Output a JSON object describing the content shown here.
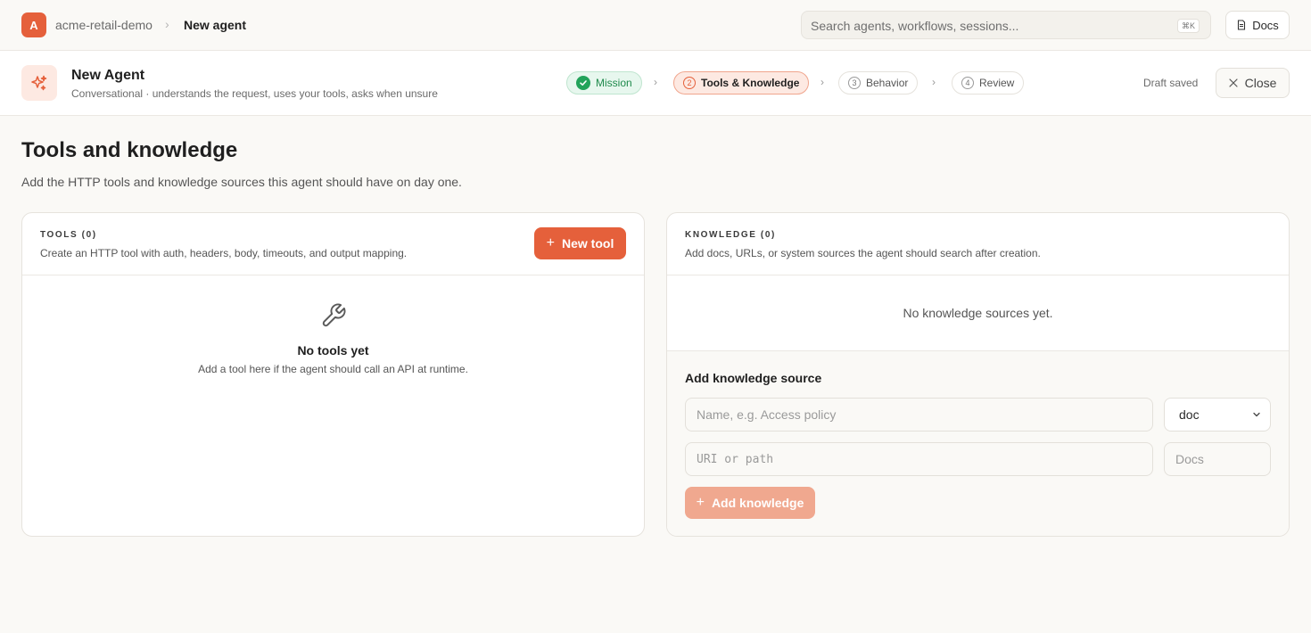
{
  "topbar": {
    "workspace_initial": "A",
    "workspace_name": "acme-retail-demo",
    "crumb_separator": "›",
    "current_page": "New agent",
    "search_placeholder": "Search agents, workflows, sessions...",
    "search_shortcut": "⌘K",
    "docs_label": "Docs"
  },
  "agent": {
    "title": "New Agent",
    "subtitle": "Conversational · understands the request, uses your tools, asks when unsure"
  },
  "steps": [
    {
      "number": "1",
      "label": "Mission",
      "state": "done"
    },
    {
      "number": "2",
      "label": "Tools & Knowledge",
      "state": "active"
    },
    {
      "number": "3",
      "label": "Behavior",
      "state": "upcoming"
    },
    {
      "number": "4",
      "label": "Review",
      "state": "upcoming"
    }
  ],
  "step_chevron": "›",
  "draft_status": "Draft saved",
  "close_label": "Close",
  "page": {
    "title": "Tools and knowledge",
    "subtitle": "Add the HTTP tools and knowledge sources this agent should have on day one."
  },
  "tools": {
    "label": "TOOLS (0)",
    "description": "Create an HTTP tool with auth, headers, body, timeouts, and output mapping.",
    "new_button": "New tool",
    "empty_title": "No tools yet",
    "empty_description": "Add a tool here if the agent should call an API at runtime."
  },
  "knowledge": {
    "label": "KNOWLEDGE (0)",
    "description": "Add docs, URLs, or system sources the agent should search after creation.",
    "empty_text": "No knowledge sources yet.",
    "add_title": "Add knowledge source",
    "name_placeholder": "Name, e.g. Access policy",
    "type_value": "doc",
    "uri_placeholder": "URI or path",
    "label_placeholder": "Docs",
    "add_button": "Add knowledge"
  },
  "colors": {
    "accent": "#e5603b",
    "accent_disabled": "#f0a88f",
    "success": "#22a35a"
  },
  "icons": {
    "agent": "sparkle-icon",
    "tools_empty": "wrench-icon",
    "docs": "document-icon",
    "close": "close-icon",
    "select": "chevron-down-icon"
  }
}
